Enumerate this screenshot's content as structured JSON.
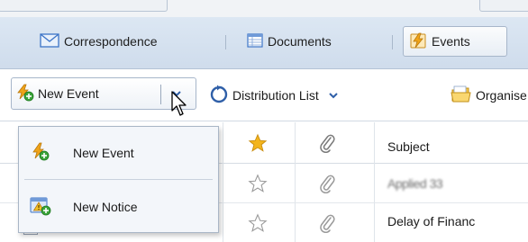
{
  "tabs": [
    {
      "label": "Correspondence",
      "icon": "envelope-icon"
    },
    {
      "label": "Documents",
      "icon": "document-grid-icon"
    },
    {
      "label": "Events",
      "icon": "lightning-calendar-icon",
      "active": true
    }
  ],
  "toolbar": {
    "new_event_label": "New Event",
    "distribution_list_label": "Distribution List",
    "organise_label": "Organise"
  },
  "dropdown": {
    "items": [
      {
        "label": "New Event",
        "icon": "new-event-icon"
      },
      {
        "label": "New Notice",
        "icon": "new-notice-icon"
      }
    ]
  },
  "table": {
    "columns": [
      "star-icon",
      "attachment-icon",
      "Subject"
    ],
    "rows": [
      {
        "id": "",
        "subject": "Applied 33",
        "subject_blurred": true
      },
      {
        "id": "260010",
        "subject": "Delay of Financ"
      }
    ]
  },
  "colors": {
    "tab_bar": "#d4e1ef",
    "star_fill": "#f3b51d",
    "accent_blue": "#2f6cc6",
    "green_badge": "#3aa33a"
  }
}
